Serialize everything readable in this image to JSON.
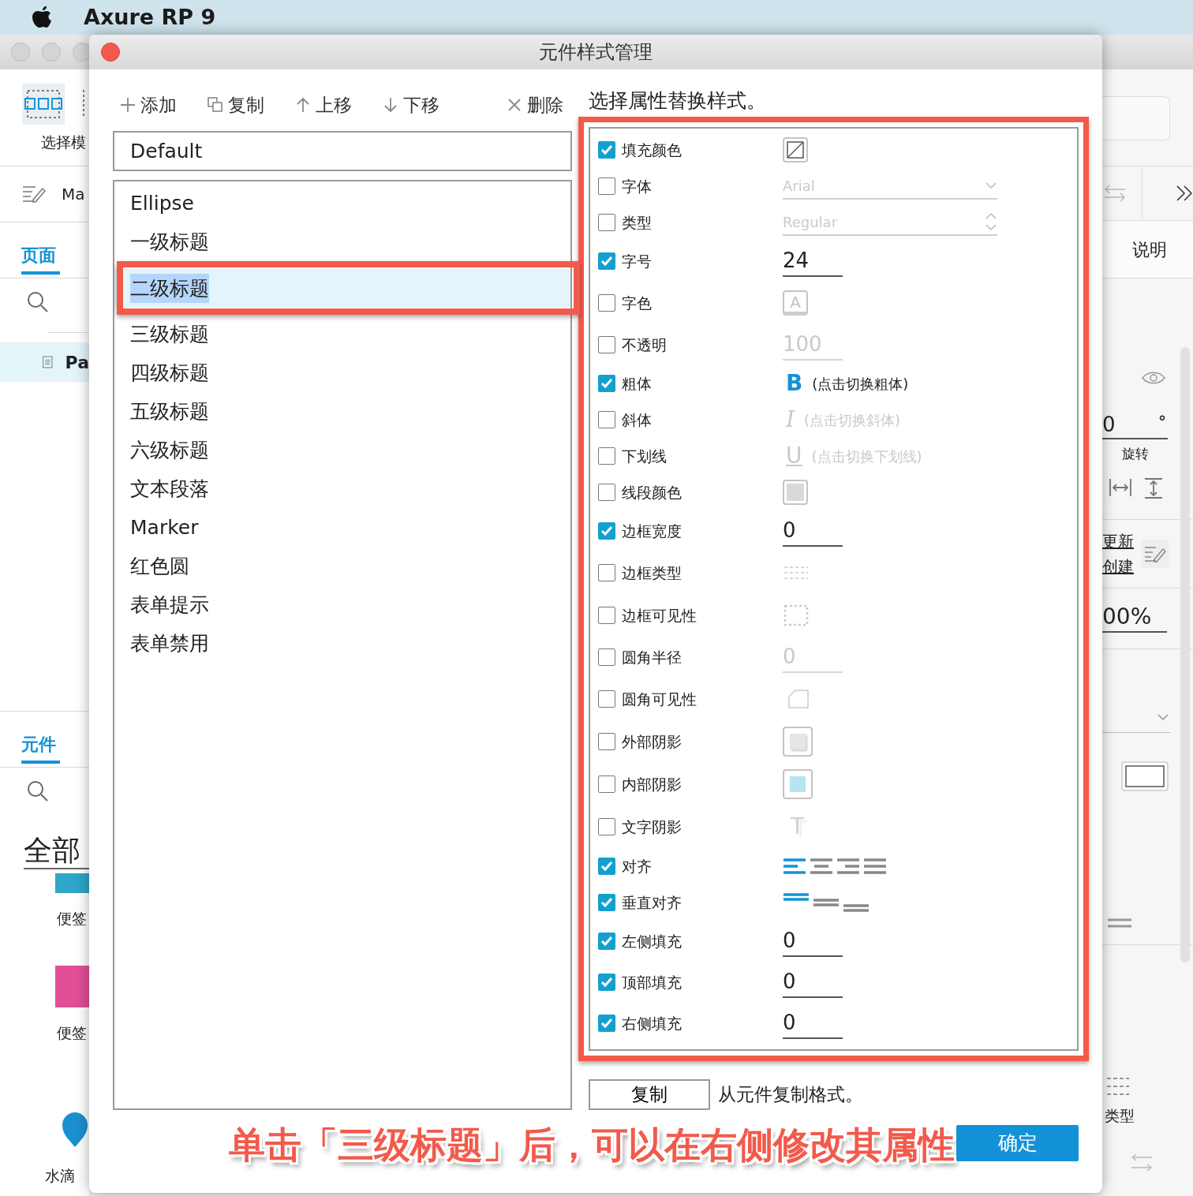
{
  "menubar": {
    "app_name": "Axure RP 9"
  },
  "background_window": {
    "left_panel": {
      "tool_label": "选择模",
      "page_name": "Ma",
      "pages_tab": {
        "label": "页面",
        "selected": true
      },
      "page_item": "Pa",
      "widgets_tab": {
        "label": "元件",
        "selected": true
      },
      "library_title": "全部",
      "widgets": [
        {
          "kind": "rect",
          "label": "便签",
          "color": "#2ea6c9"
        },
        {
          "kind": "rect",
          "label": "便签",
          "color": "#e24f97"
        },
        {
          "kind": "drop",
          "label": "水滴",
          "color": "#1b90d0"
        }
      ]
    },
    "right_panel": {
      "tab": "说明",
      "rotation_value": "0",
      "rotation_unit": "°",
      "rotation_label": "旋转",
      "links": [
        "更新",
        "创建"
      ],
      "opacity_value": "00%",
      "type_label": "类型"
    }
  },
  "dialog": {
    "title": "元件样式管理",
    "toolbar": [
      {
        "kind": "add",
        "label": "添加"
      },
      {
        "kind": "copy",
        "label": "复制"
      },
      {
        "kind": "up",
        "label": "上移"
      },
      {
        "kind": "down",
        "label": "下移"
      },
      {
        "kind": "delete",
        "label": "删除"
      }
    ],
    "default_style": "Default",
    "styles": [
      {
        "name": "Ellipse",
        "selected": false,
        "outlined": false
      },
      {
        "name": "一级标题",
        "selected": false,
        "outlined": false
      },
      {
        "name": "二级标题",
        "selected": true,
        "outlined": true
      },
      {
        "name": "三级标题",
        "selected": false,
        "outlined": false
      },
      {
        "name": "四级标题",
        "selected": false,
        "outlined": false
      },
      {
        "name": "五级标题",
        "selected": false,
        "outlined": false
      },
      {
        "name": "六级标题",
        "selected": false,
        "outlined": false
      },
      {
        "name": "文本段落",
        "selected": false,
        "outlined": false
      },
      {
        "name": "Marker",
        "selected": false,
        "outlined": false
      },
      {
        "name": "红色圆",
        "selected": false,
        "outlined": false
      },
      {
        "name": "表单提示",
        "selected": false,
        "outlined": false
      },
      {
        "name": "表单禁用",
        "selected": false,
        "outlined": false
      }
    ],
    "instruction": "选择属性替换样式。",
    "properties_outlined": true,
    "properties": [
      {
        "label": "填充颜色",
        "checked": true,
        "kind": "fill-swatch"
      },
      {
        "label": "字体",
        "checked": false,
        "kind": "select",
        "value": "Arial"
      },
      {
        "label": "类型",
        "checked": false,
        "kind": "spinner-select",
        "value": "Regular"
      },
      {
        "label": "字号",
        "checked": true,
        "kind": "number",
        "value": "24"
      },
      {
        "label": "字色",
        "checked": false,
        "kind": "font-color",
        "glyph": "A"
      },
      {
        "label": "不透明",
        "checked": false,
        "kind": "number",
        "value": "100"
      },
      {
        "label": "粗体",
        "checked": true,
        "kind": "bold-toggle",
        "glyph": "B",
        "hint": "(点击切换粗体)"
      },
      {
        "label": "斜体",
        "checked": false,
        "kind": "italic-toggle",
        "glyph": "I",
        "hint": "(点击切换斜体)"
      },
      {
        "label": "下划线",
        "checked": false,
        "kind": "underline-toggle",
        "glyph": "U",
        "hint": "(点击切换下划线)"
      },
      {
        "label": "线段颜色",
        "checked": false,
        "kind": "line-swatch"
      },
      {
        "label": "边框宽度",
        "checked": true,
        "kind": "number",
        "value": "0"
      },
      {
        "label": "边框类型",
        "checked": false,
        "kind": "border-style"
      },
      {
        "label": "边框可见性",
        "checked": false,
        "kind": "border-visibility"
      },
      {
        "label": "圆角半径",
        "checked": false,
        "kind": "number",
        "value": "0"
      },
      {
        "label": "圆角可见性",
        "checked": false,
        "kind": "corner"
      },
      {
        "label": "外部阴影",
        "checked": false,
        "kind": "outer-shadow"
      },
      {
        "label": "内部阴影",
        "checked": false,
        "kind": "inner-shadow"
      },
      {
        "label": "文字阴影",
        "checked": false,
        "kind": "text-shadow",
        "glyph": "T"
      },
      {
        "label": "对齐",
        "checked": true,
        "kind": "align",
        "choices": [
          {
            "selected": true
          },
          {
            "selected": false
          },
          {
            "selected": false
          },
          {
            "selected": false
          }
        ]
      },
      {
        "label": "垂直对齐",
        "checked": true,
        "kind": "valign",
        "choices": [
          {
            "selected": true
          },
          {
            "selected": false
          },
          {
            "selected": false
          }
        ]
      },
      {
        "label": "左侧填充",
        "checked": true,
        "kind": "number",
        "value": "0"
      },
      {
        "label": "顶部填充",
        "checked": true,
        "kind": "number",
        "value": "0"
      },
      {
        "label": "右侧填充",
        "checked": true,
        "kind": "number",
        "value": "0"
      }
    ],
    "copy_button": "复制",
    "copy_hint": "从元件复制格式。",
    "annotation": "单击「三级标题」后，可以在右侧修改其属性",
    "ok_button": "确定"
  }
}
